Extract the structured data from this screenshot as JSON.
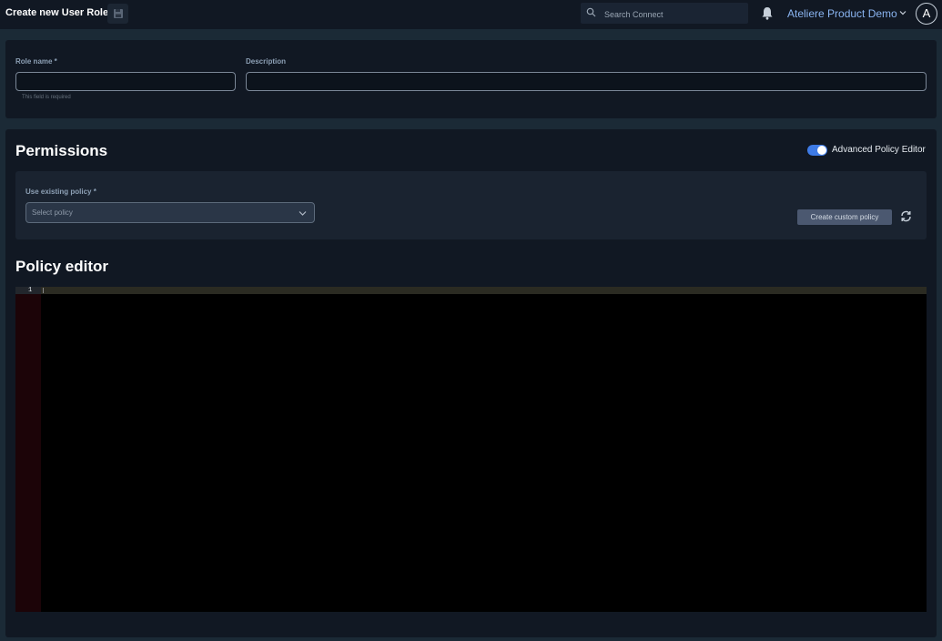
{
  "header": {
    "title": "Create new User Role",
    "search_placeholder": "Search Connect",
    "org_name": "Ateliere Product Demo",
    "avatar_initial": "A"
  },
  "role_form": {
    "role_name_label": "Role name *",
    "role_name_value": "",
    "role_name_helper": "This field is required",
    "description_label": "Description",
    "description_value": ""
  },
  "permissions": {
    "heading": "Permissions",
    "toggle_label": "Advanced Policy Editor",
    "toggle_on": true,
    "policy_label": "Use existing policy *",
    "policy_select_value": "Select policy",
    "create_button": "Create custom policy"
  },
  "policy_editor": {
    "heading": "Policy editor",
    "line_numbers": [
      "1"
    ]
  },
  "colors": {
    "accent": "#3e7be6",
    "org_link": "#8ab4f0",
    "background": "#1b2a36",
    "panel": "#111823"
  }
}
